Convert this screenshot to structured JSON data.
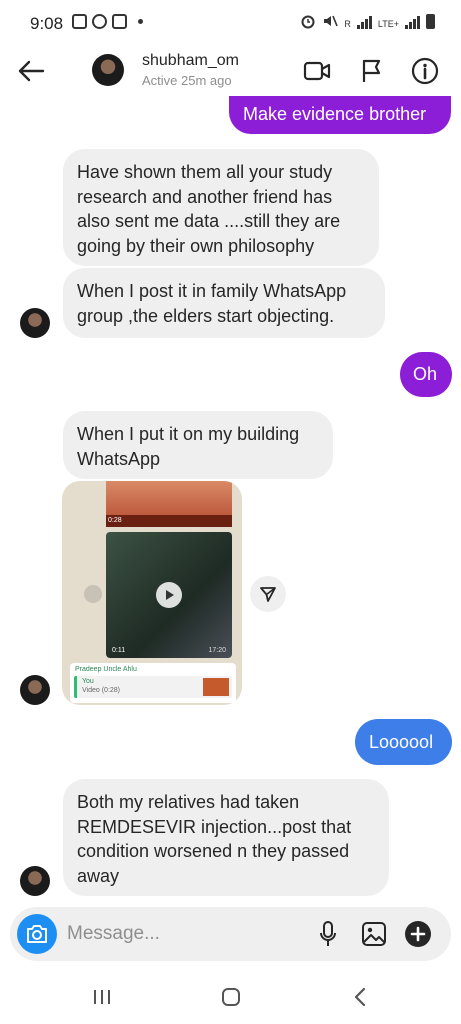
{
  "status_bar": {
    "time": "9:08",
    "network": "LTE+",
    "sim": "R"
  },
  "header": {
    "username": "shubham_om",
    "active_status": "Active 25m ago",
    "icons": [
      "back-arrow-icon",
      "video-call-icon",
      "flag-icon",
      "info-icon"
    ]
  },
  "messages": [
    {
      "direction": "outgoing",
      "text": "Make evidence brother",
      "color": "#8d1ed8"
    },
    {
      "direction": "incoming",
      "text": "Have shown them all your study research and another friend has also sent me data ....still they are going by their own philosophy"
    },
    {
      "direction": "incoming",
      "text": "When I post it in family WhatsApp group ,the elders start objecting."
    },
    {
      "direction": "outgoing",
      "text": "Oh",
      "color": "#8d1ed8"
    },
    {
      "direction": "incoming",
      "text": "When I put it on my building WhatsApp"
    },
    {
      "direction": "outgoing",
      "text": "Loooool",
      "color": "#3d7ee8"
    },
    {
      "direction": "incoming",
      "text": "Both my relatives had taken REMDESEVIR injection...post that condition worsened n they passed away"
    }
  ],
  "shared_media": {
    "top_clip_time": "0:28",
    "video_duration": "0:11",
    "video_timestamp": "17:20",
    "reply_sender": "Pradeep Uncle Ahlu",
    "reply_you": "You",
    "reply_video": "Video (0:28)"
  },
  "composer": {
    "placeholder": "Message...",
    "accent": "#1e8ff2"
  },
  "nav_bar": {
    "icons": [
      "recent-apps-icon",
      "home-icon",
      "back-icon"
    ]
  }
}
